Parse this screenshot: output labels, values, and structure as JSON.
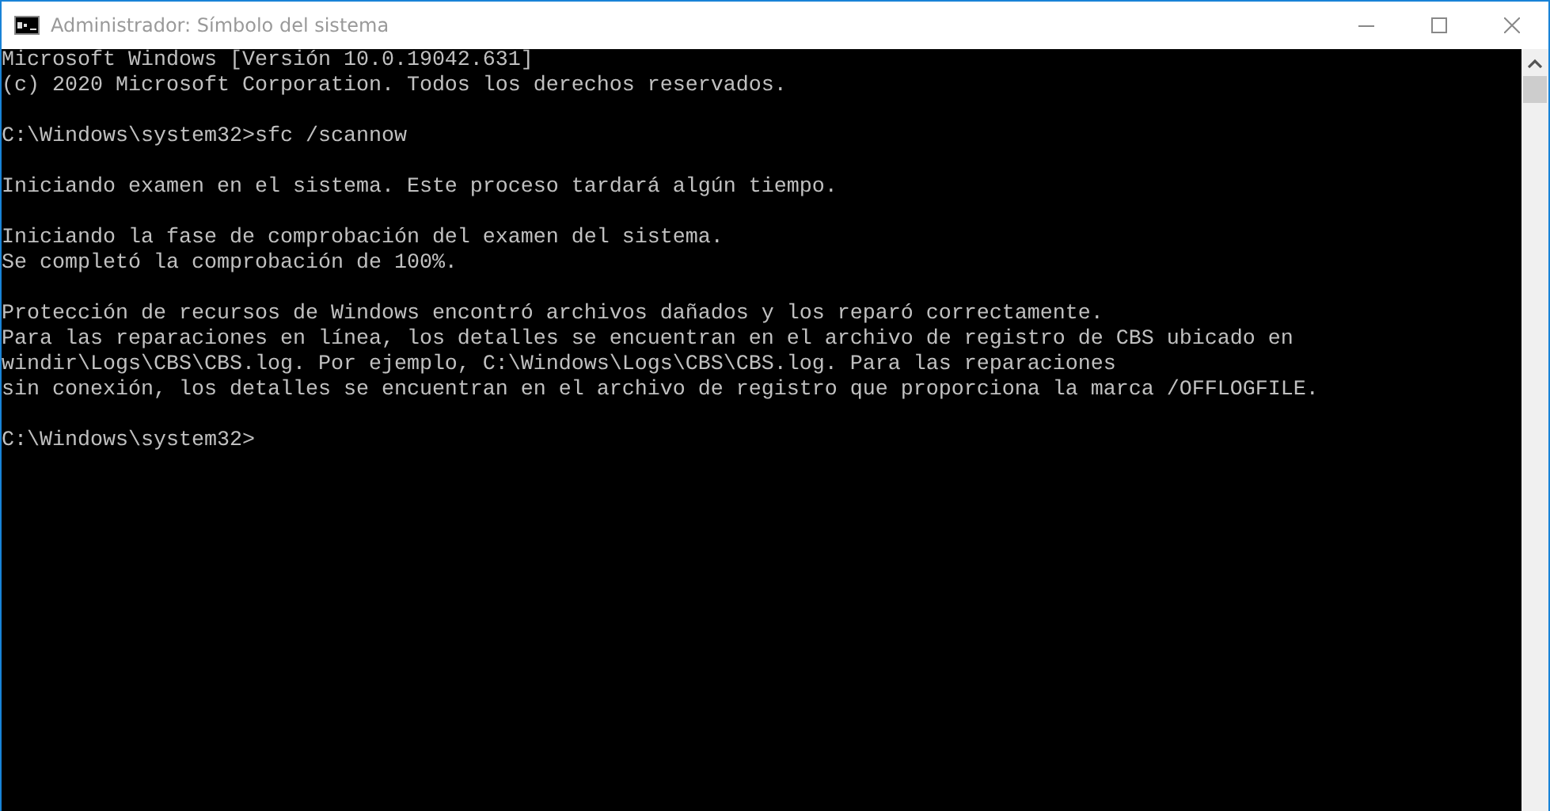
{
  "window": {
    "title": "Administrador: Símbolo del sistema"
  },
  "console": {
    "blocks": [
      [
        "Microsoft Windows [Versión 10.0.19042.631]",
        "(c) 2020 Microsoft Corporation. Todos los derechos reservados."
      ],
      [
        "C:\\Windows\\system32>sfc /scannow"
      ],
      [
        "Iniciando examen en el sistema. Este proceso tardará algún tiempo."
      ],
      [
        "Iniciando la fase de comprobación del examen del sistema.",
        "Se completó la comprobación de 100%."
      ],
      [
        "Protección de recursos de Windows encontró archivos dañados y los reparó correctamente.",
        "Para las reparaciones en línea, los detalles se encuentran en el archivo de registro de CBS ubicado en",
        "windir\\Logs\\CBS\\CBS.log. Por ejemplo, C:\\Windows\\Logs\\CBS\\CBS.log. Para las reparaciones",
        "sin conexión, los detalles se encuentran en el archivo de registro que proporciona la marca /OFFLOGFILE."
      ],
      [
        "C:\\Windows\\system32>"
      ]
    ]
  }
}
